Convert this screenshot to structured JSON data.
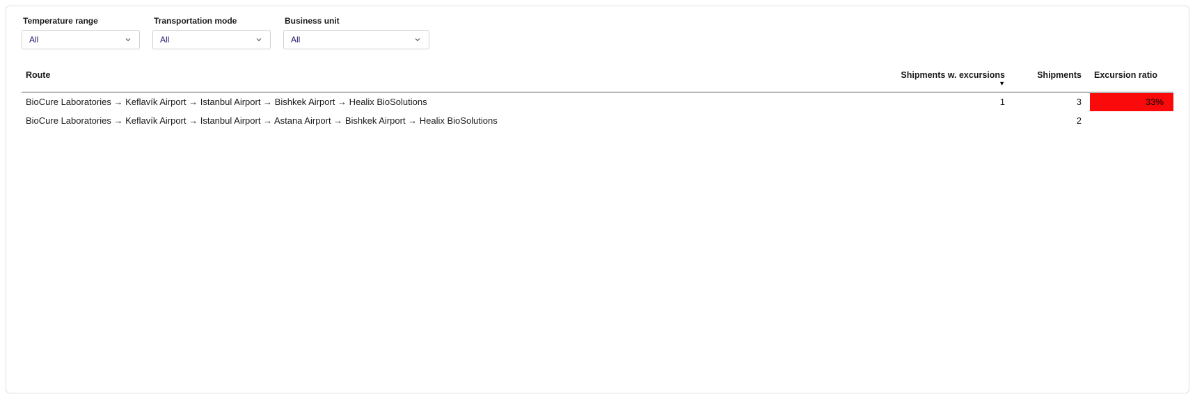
{
  "filters": {
    "temperature": {
      "label": "Temperature range",
      "value": "All"
    },
    "transport": {
      "label": "Transportation mode",
      "value": "All"
    },
    "business": {
      "label": "Business unit",
      "value": "All"
    }
  },
  "table": {
    "headers": {
      "route": "Route",
      "shipments_excursions": "Shipments w. excursions",
      "shipments": "Shipments",
      "excursion_ratio": "Excursion ratio"
    },
    "rows": [
      {
        "route": "BioCure Laboratories → Keflavík Airport → Istanbul Airport → Bishkek Airport → Healix BioSolutions",
        "shipments_excursions": "1",
        "shipments": "3",
        "excursion_ratio": "33%",
        "ratio_bg": "#fa0a0a"
      },
      {
        "route": "BioCure Laboratories → Keflavík Airport → Istanbul Airport → Astana Airport  → Bishkek Airport → Healix BioSolutions",
        "shipments_excursions": "",
        "shipments": "2",
        "excursion_ratio": "",
        "ratio_bg": ""
      }
    ]
  }
}
